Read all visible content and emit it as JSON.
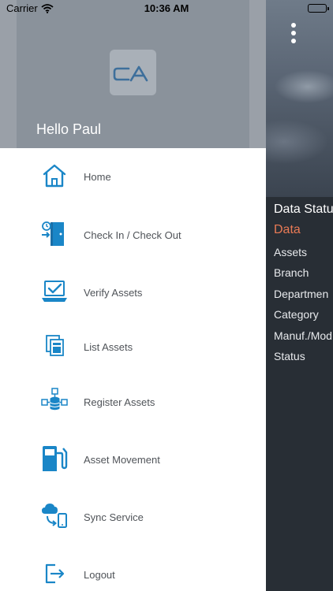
{
  "status_bar": {
    "carrier": "Carrier",
    "time": "10:36 AM"
  },
  "drawer": {
    "logo_text": "CA",
    "greeting": "Hello Paul",
    "accent_color": "#1a86c7",
    "items": [
      {
        "label": "Home",
        "icon": "home-icon"
      },
      {
        "label": "Check In / Check Out",
        "icon": "door-clock-icon"
      },
      {
        "label": "Verify Assets",
        "icon": "laptop-check-icon"
      },
      {
        "label": "List Assets",
        "icon": "list-pages-icon"
      },
      {
        "label": "Register Assets",
        "icon": "database-network-icon"
      },
      {
        "label": "Asset Movement",
        "icon": "fuel-pump-icon"
      },
      {
        "label": "Sync Service",
        "icon": "cloud-sync-icon"
      },
      {
        "label": "Logout",
        "icon": "logout-icon"
      }
    ]
  },
  "background": {
    "panel_title": "Data Statu",
    "panel_subtitle": "Data",
    "subtitle_color": "#e97a55",
    "rows": [
      "Assets",
      "Branch",
      "Departmen",
      "Category",
      "Manuf./Mod",
      "Status"
    ]
  }
}
